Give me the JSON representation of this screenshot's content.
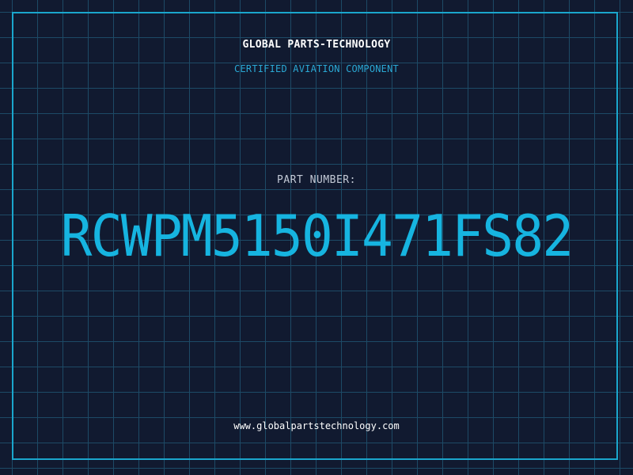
{
  "header": {
    "company": "GLOBAL PARTS-TECHNOLOGY",
    "subtitle": "CERTIFIED AVIATION COMPONENT"
  },
  "part": {
    "label": "PART NUMBER:",
    "number": "RCWPM5150I471FS82"
  },
  "footer": {
    "website": "www.globalpartstechnology.com"
  },
  "colors": {
    "background": "#111a30",
    "grid": "#1d4a66",
    "frame": "#1aa6cc",
    "accent": "#16b4e0",
    "label": "#c3cad6",
    "text": "#ffffff"
  }
}
